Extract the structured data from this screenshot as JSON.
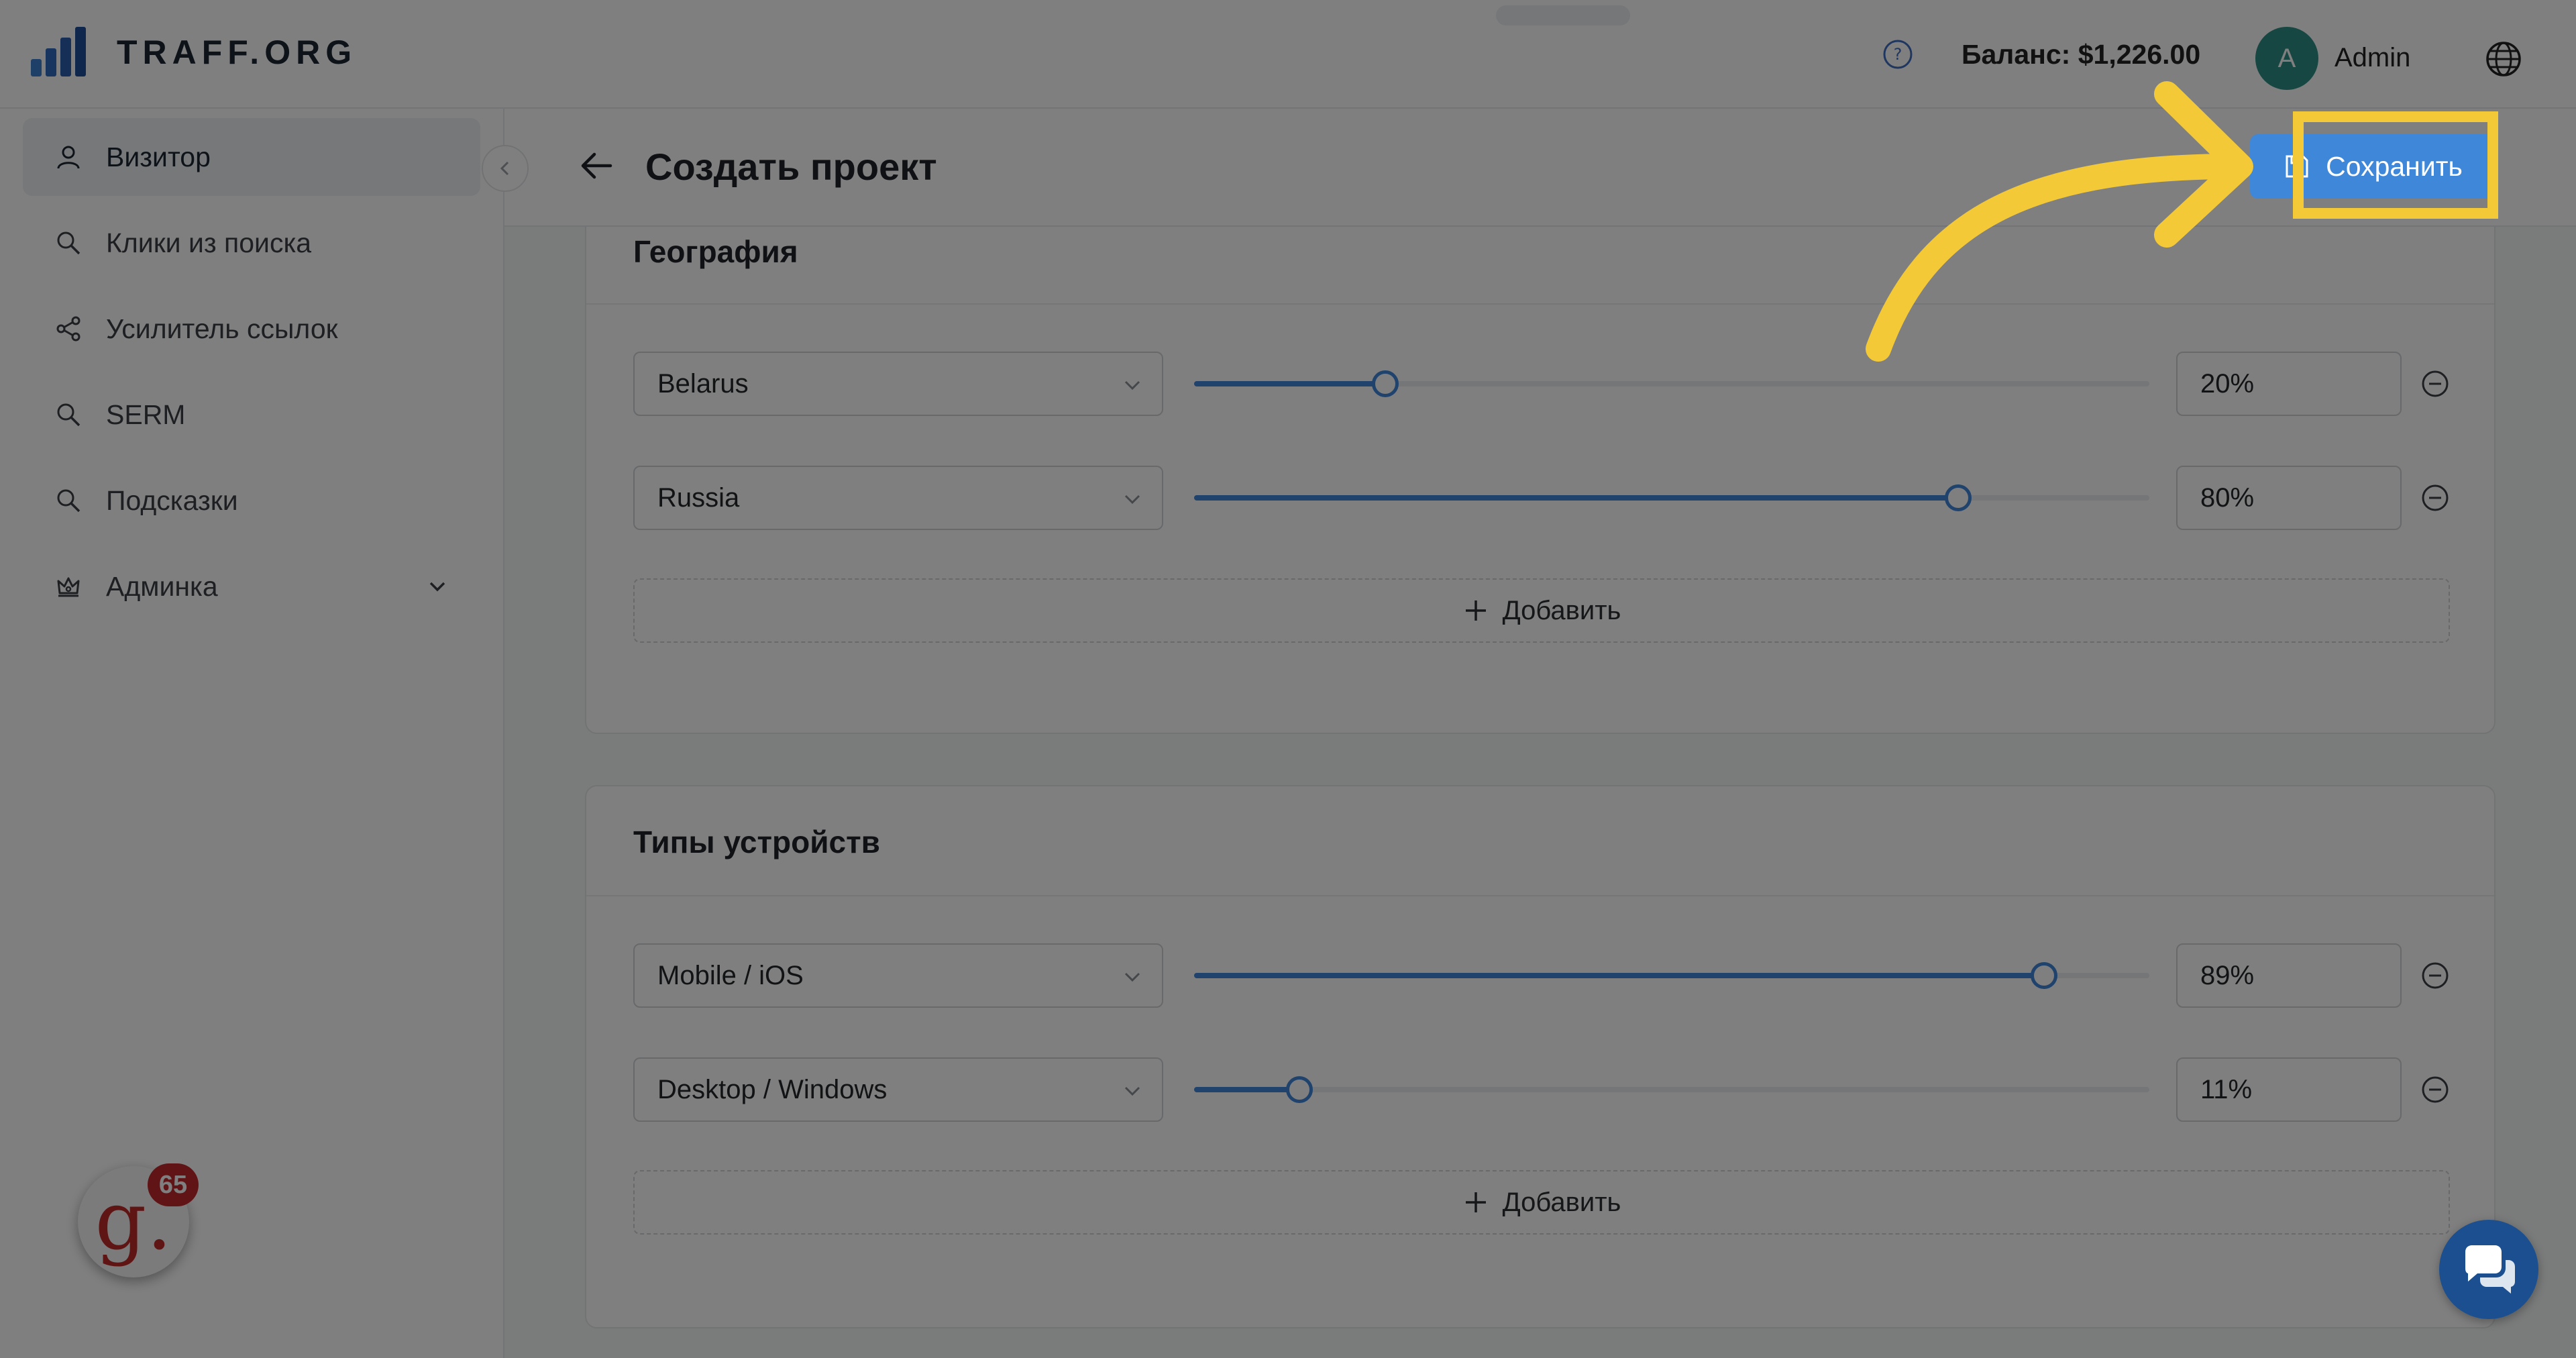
{
  "header": {
    "brand": "TRAFF.ORG",
    "balance": "Баланс: $1,226.00",
    "user": {
      "initial": "A",
      "name": "Admin"
    }
  },
  "sidebar": {
    "items": [
      {
        "label": "Визитор",
        "icon": "user-icon",
        "active": true
      },
      {
        "label": "Клики из поиска",
        "icon": "search-icon"
      },
      {
        "label": "Усилитель ссылок",
        "icon": "share-icon"
      },
      {
        "label": "SERM",
        "icon": "search-icon"
      },
      {
        "label": "Подсказки",
        "icon": "search-icon"
      },
      {
        "label": "Админка",
        "icon": "crown-icon",
        "expandable": true
      }
    ]
  },
  "page": {
    "title": "Создать проект",
    "save_label": "Сохранить"
  },
  "geography": {
    "title": "География",
    "rows": [
      {
        "option": "Belarus",
        "percent": 20,
        "value": "20%"
      },
      {
        "option": "Russia",
        "percent": 80,
        "value": "80%"
      }
    ],
    "add_label": "Добавить"
  },
  "devices": {
    "title": "Типы устройств",
    "rows": [
      {
        "option": "Mobile / iOS",
        "percent": 89,
        "value": "89%"
      },
      {
        "option": "Desktop / Windows",
        "percent": 11,
        "value": "11%"
      }
    ],
    "add_label": "Добавить"
  },
  "widgets": {
    "gnotes_badge": "65"
  },
  "colors": {
    "accent": "#3f87d8",
    "highlight": "#f4c938",
    "avatar": "#2f8f84",
    "chat": "#1b4f8f"
  }
}
